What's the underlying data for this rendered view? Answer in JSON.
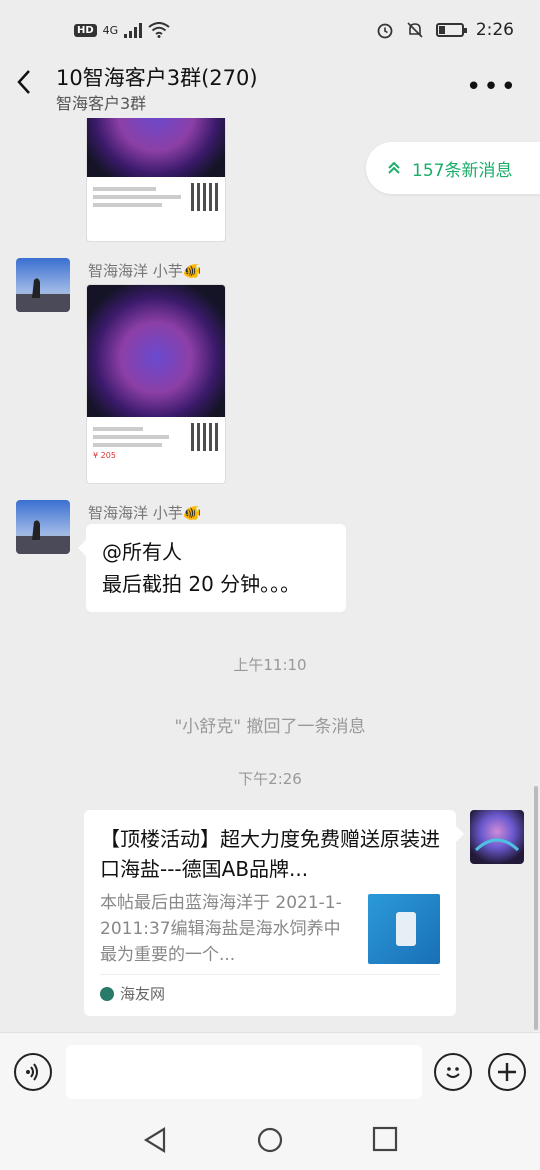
{
  "status_bar": {
    "hd": "HD",
    "network": "4G",
    "time": "2:26",
    "battery_level": 0.3
  },
  "header": {
    "title": "10智海客户3群(270)",
    "subtitle": "智海客户3群",
    "back_icon": "chevron-left-icon",
    "more_icon": "more-horizontal-icon"
  },
  "new_messages": {
    "label": "157条新消息",
    "icon": "double-chevron-up-icon"
  },
  "messages": [
    {
      "type": "image",
      "sender": "智海海洋 小芋🐠",
      "card_price": "¥ 205"
    },
    {
      "type": "text",
      "sender": "智海海洋 小芋🐠",
      "line1": "@所有人",
      "line2": "最后截拍 20 分钟。。。"
    }
  ],
  "timestamps": {
    "t1": "上午11:10",
    "t2": "下午2:26"
  },
  "system_message": "\"小舒克\" 撤回了一条消息",
  "link_card": {
    "title": "【顶楼活动】超大力度免费赠送原装进口海盐---德国AB品牌...",
    "description": "本帖最后由蓝海海洋于 2021-1-2011:37编辑海盐是海水饲养中最为重要的一个...",
    "source": "海友网"
  },
  "input_bar": {
    "voice_icon": "voice-icon",
    "emoji_icon": "emoji-icon",
    "plus_icon": "plus-icon"
  }
}
